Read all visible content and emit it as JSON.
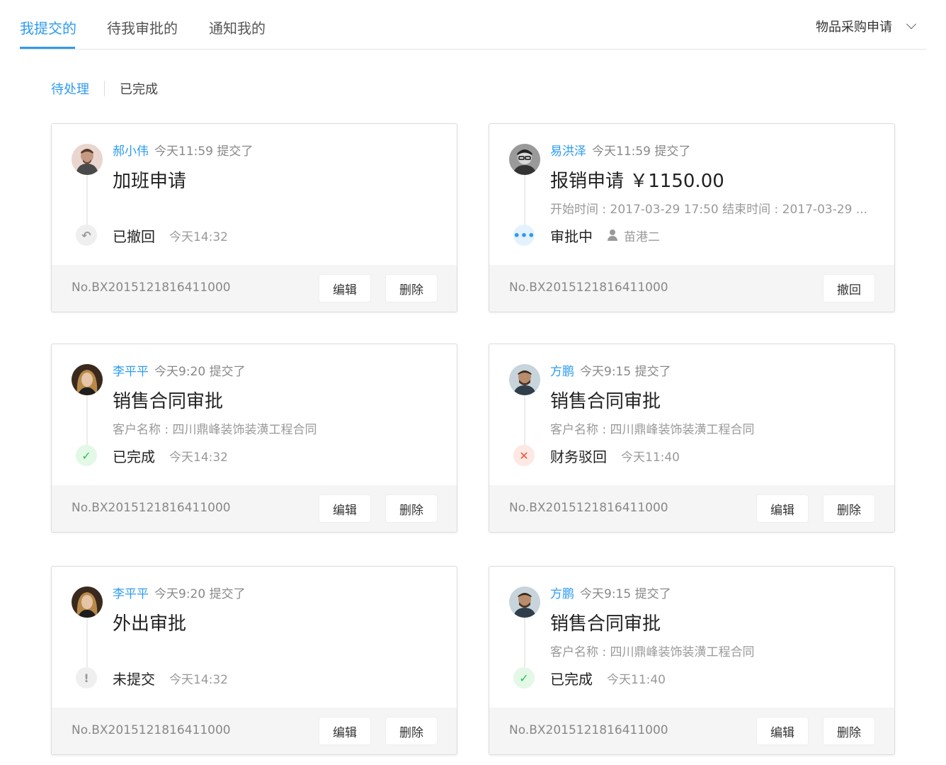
{
  "tabs": [
    {
      "label": "我提交的"
    },
    {
      "label": "待我审批的"
    },
    {
      "label": "通知我的"
    }
  ],
  "dropdown": {
    "label": "物品采购申请"
  },
  "filters": [
    {
      "label": "待处理"
    },
    {
      "label": "已完成"
    }
  ],
  "cards": [
    {
      "name": "郝小伟",
      "time": "今天11:59 提交了",
      "title": "加班申请",
      "subline": "",
      "status": "已撤回",
      "status_time": "今天14:32",
      "status_type": "gray",
      "status_icon": "undo-icon",
      "order_no": "No.BX201512181641​1000",
      "buttons": [
        "编辑",
        "删除"
      ]
    },
    {
      "name": "易洪泽",
      "time": "今天11:59 提交了",
      "title": "报销申请 ￥1150.00",
      "subline": "开始时间 : 2017-03-29 17:50  结束时间 : 2017-03-29 ...",
      "status": "审批中",
      "approver": "苗港二",
      "status_type": "blue",
      "status_icon": "ellipsis-icon",
      "order_no": "No.BX2015121816411000",
      "buttons": [
        "撤回"
      ]
    },
    {
      "name": "李平平",
      "time": "今天9:20 提交了",
      "title": "销售合同审批",
      "subline": "客户名称 : 四川鼎峰装饰装潢工程合同",
      "status": "已完成",
      "status_time": "今天14:32",
      "status_type": "green",
      "status_icon": "check-icon",
      "order_no": "No.BX2015121816411000",
      "buttons": [
        "编辑",
        "删除"
      ]
    },
    {
      "name": "方鹏",
      "time": "今天9:15 提交了",
      "title": "销售合同审批",
      "subline": "客户名称 : 四川鼎峰装饰装潢工程合同",
      "status": "财务驳回",
      "status_time": "今天11:40",
      "status_type": "red",
      "status_icon": "close-icon",
      "order_no": "No.BX2015121816411000",
      "buttons": [
        "编辑",
        "删除"
      ]
    },
    {
      "name": "李平平",
      "time": "今天9:20 提交了",
      "title": "外出审批",
      "subline": "",
      "status": "未提交",
      "status_time": "今天14:32",
      "status_type": "gray",
      "status_icon": "exclamation-icon",
      "order_no": "No.BX2015121816411000",
      "buttons": [
        "编辑",
        "删除"
      ]
    },
    {
      "name": "方鹏",
      "time": "今天9:15 提交了",
      "title": "销售合同审批",
      "subline": "客户名称 : 四川鼎峰装饰装潢工程合同",
      "status": "已完成",
      "status_time": "今天11:40",
      "status_type": "green",
      "status_icon": "check-icon",
      "order_no": "No.BX2015121816411000",
      "buttons": [
        "编辑",
        "删除"
      ]
    }
  ],
  "colors": {
    "accent": "#2d9bf0",
    "success": "#29c24a",
    "danger": "#f0553b"
  }
}
